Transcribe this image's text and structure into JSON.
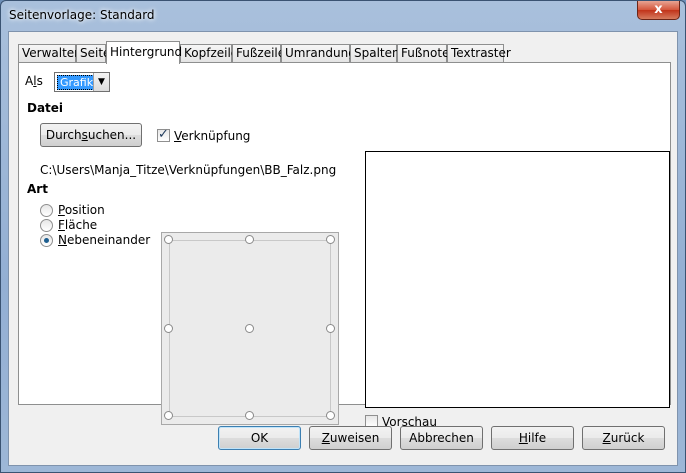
{
  "window": {
    "title": "Seitenvorlage: Standard",
    "close_label": "x"
  },
  "tabs": [
    {
      "label": "Verwalten"
    },
    {
      "label": "Seite"
    },
    {
      "label": "Hintergrund"
    },
    {
      "label": "Kopfzeile"
    },
    {
      "label": "Fußzeile"
    },
    {
      "label": "Umrandung"
    },
    {
      "label": "Spalten"
    },
    {
      "label": "Fußnote"
    },
    {
      "label": "Textraster"
    }
  ],
  "als": {
    "label_pre": "A",
    "label_u": "l",
    "label_post": "s",
    "value": "Grafik"
  },
  "datei": {
    "heading": "Datei",
    "browse_pre": "Durch",
    "browse_u": "s",
    "browse_post": "uchen...",
    "link_u": "V",
    "link_post": "erknüpfung",
    "link_checked": true,
    "path": "C:\\Users\\Manja_Titze\\Verknüpfungen\\BB_Falz.png"
  },
  "art": {
    "heading": "Art",
    "options": [
      {
        "u": "P",
        "rest": "osition",
        "checked": false
      },
      {
        "u": "F",
        "rest": "läche",
        "checked": false
      },
      {
        "u": "N",
        "rest": "ebeneinander",
        "checked": true
      }
    ]
  },
  "preview": {
    "pre": "Vor",
    "u": "s",
    "post": "chau",
    "checked": false
  },
  "buttons": {
    "ok": "OK",
    "reset_u": "Z",
    "reset_post": "uweisen",
    "cancel": "Abbrechen",
    "help_u": "H",
    "help_post": "ilfe",
    "back_u": "Z",
    "back_post": "urück"
  }
}
